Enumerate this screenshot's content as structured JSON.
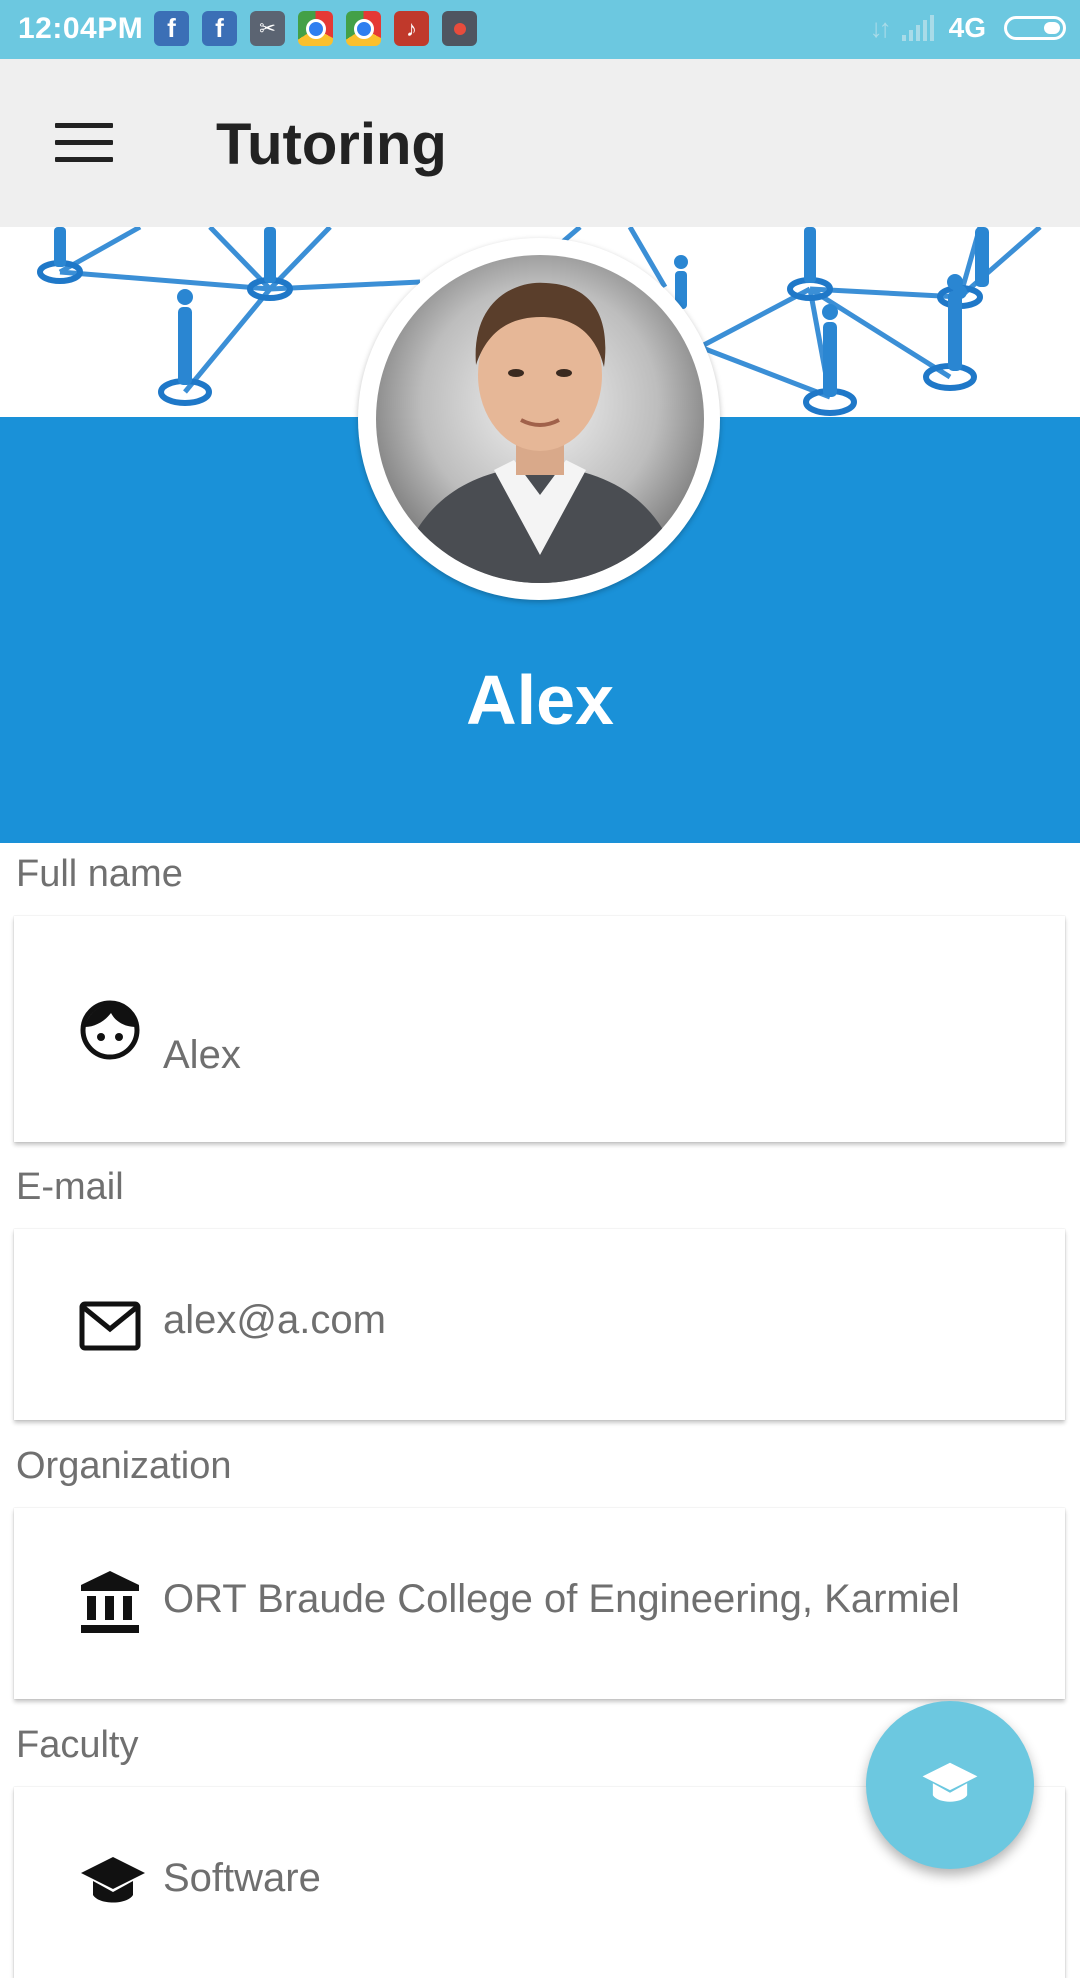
{
  "status_bar": {
    "time": "12:04PM",
    "network": "4G",
    "apps": [
      "facebook-icon",
      "facebook-icon",
      "scissors-app-icon",
      "chrome-icon",
      "chrome-icon",
      "tiktok-icon",
      "screen-recorder-icon"
    ]
  },
  "app_bar": {
    "title": "Tutoring"
  },
  "profile": {
    "name": "Alex"
  },
  "fields": {
    "full_name": {
      "label": "Full name",
      "value": "Alex"
    },
    "email": {
      "label": "E-mail",
      "value": "alex@a.com"
    },
    "organization": {
      "label": "Organization",
      "value": "ORT Braude College of Engineering, Karmiel"
    },
    "faculty": {
      "label": "Faculty",
      "value": "Software"
    }
  },
  "colors": {
    "status_bar": "#6cc8e0",
    "app_bar": "#efefef",
    "header_band": "#1a91d8",
    "fab": "#6cc8e0"
  }
}
